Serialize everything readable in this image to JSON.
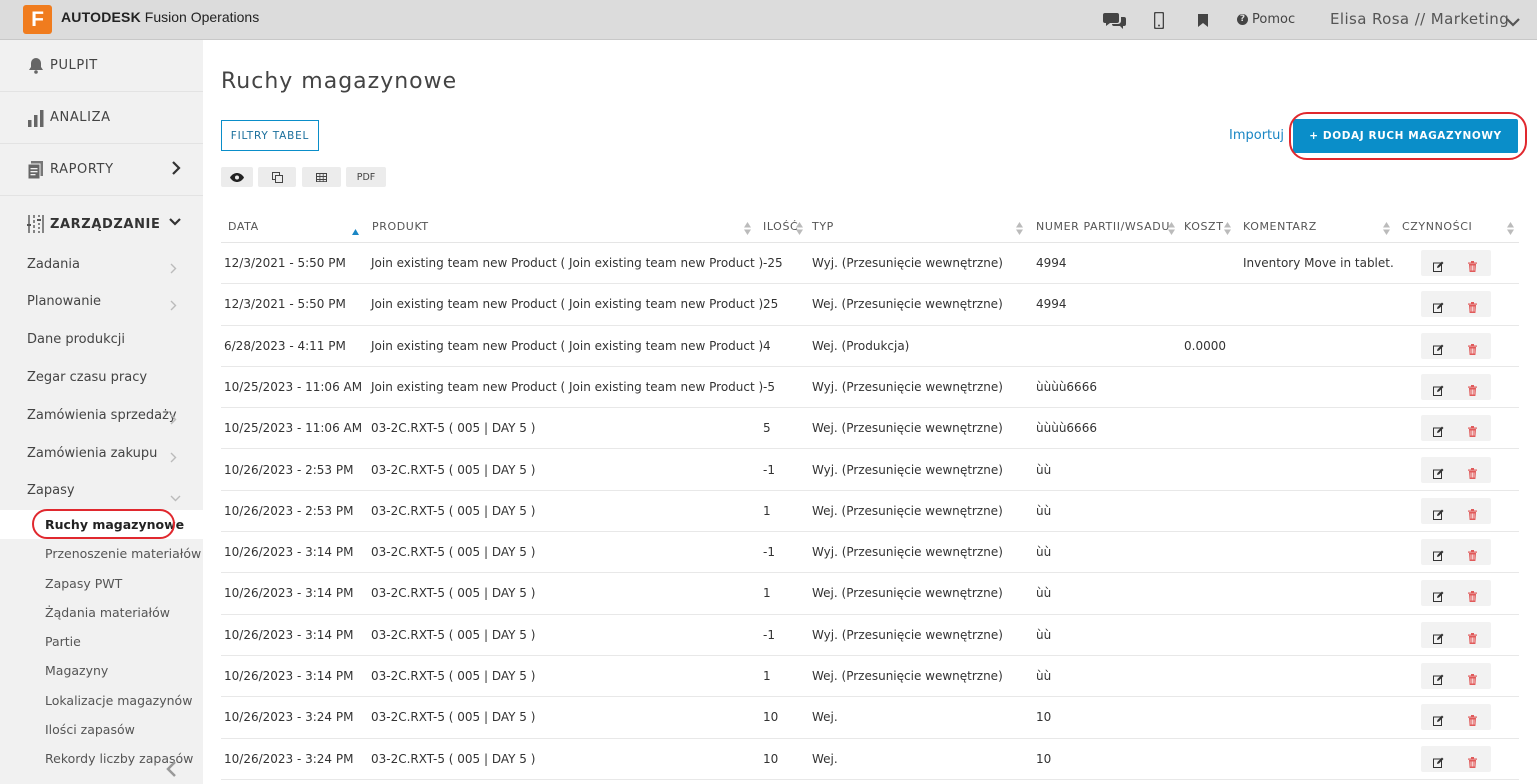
{
  "header": {
    "logo_letter": "F",
    "brand_bold": "AUTODESK",
    "brand_rest": " Fusion Operations",
    "help_label": "Pomoc",
    "user_label": "Elisa Rosa // Marketing",
    "icons": [
      "chat-icon",
      "mobile-icon",
      "bookmark-icon",
      "help-icon",
      "chevron-down-icon"
    ]
  },
  "sidebar": {
    "main": [
      {
        "label": "PULPIT",
        "icon": "bell-icon"
      },
      {
        "label": "ANALIZA",
        "icon": "bar-chart-icon"
      },
      {
        "label": "RAPORTY",
        "icon": "report-icon"
      },
      {
        "label": "ZARZĄDZANIE",
        "icon": "sliders-icon"
      }
    ],
    "sub": [
      {
        "label": "Zadania",
        "chevron": true
      },
      {
        "label": "Planowanie",
        "chevron": true
      },
      {
        "label": "Dane produkcji",
        "chevron": false
      },
      {
        "label": "Zegar czasu pracy",
        "chevron": false
      },
      {
        "label": "Zamówienia sprzedaży",
        "chevron": true
      },
      {
        "label": "Zamówienia zakupu",
        "chevron": true
      },
      {
        "label": "Zapasy",
        "chevron": true
      }
    ],
    "stock_items": [
      "Ruchy magazynowe",
      "Przenoszenie materiałów",
      "Zapasy PWT",
      "Żądania materiałów",
      "Partie",
      "Magazyny",
      "Lokalizacje magazynów",
      "Ilości zapasów",
      "Rekordy liczby zapasów"
    ]
  },
  "main": {
    "title": "Ruchy magazynowe",
    "filter_button": "FILTRY TABEL",
    "toolbar": [
      "eye-icon",
      "copy-icon",
      "table-icon",
      "PDF"
    ],
    "pdf_label": "PDF",
    "import_label": "Importuj",
    "add_button": "+ DODAJ RUCH MAGAZYNOWY"
  },
  "table": {
    "columns": [
      "DATA",
      "PRODUKT",
      "ILOŚĆ",
      "TYP",
      "NUMER PARTII/WSADU",
      "KOSZT",
      "KOMENTARZ",
      "CZYNNOŚCI"
    ],
    "rows": [
      [
        "12/3/2021 - 5:50 PM",
        "Join existing team new Product ( Join existing team new Product )",
        "-25",
        "Wyj. (Przesunięcie wewnętrzne)",
        "4994",
        "",
        "Inventory Move in tablet."
      ],
      [
        "12/3/2021 - 5:50 PM",
        "Join existing team new Product ( Join existing team new Product )",
        "25",
        "Wej. (Przesunięcie wewnętrzne)",
        "4994",
        "",
        ""
      ],
      [
        "6/28/2023 - 4:11 PM",
        "Join existing team new Product ( Join existing team new Product )",
        "4",
        "Wej. (Produkcja)",
        "",
        "0.0000",
        ""
      ],
      [
        "10/25/2023 - 11:06 AM",
        "Join existing team new Product ( Join existing team new Product )",
        "-5",
        "Wyj. (Przesunięcie wewnętrzne)",
        "ùùùù6666",
        "",
        ""
      ],
      [
        "10/25/2023 - 11:06 AM",
        "03-2C.RXT-5 ( 005 | DAY 5 )",
        "5",
        "Wej. (Przesunięcie wewnętrzne)",
        "ùùùù6666",
        "",
        ""
      ],
      [
        "10/26/2023 - 2:53 PM",
        "03-2C.RXT-5 ( 005 | DAY 5 )",
        "-1",
        "Wyj. (Przesunięcie wewnętrzne)",
        "ùù",
        "",
        ""
      ],
      [
        "10/26/2023 - 2:53 PM",
        "03-2C.RXT-5 ( 005 | DAY 5 )",
        "1",
        "Wej. (Przesunięcie wewnętrzne)",
        "ùù",
        "",
        ""
      ],
      [
        "10/26/2023 - 3:14 PM",
        "03-2C.RXT-5 ( 005 | DAY 5 )",
        "-1",
        "Wyj. (Przesunięcie wewnętrzne)",
        "ùù",
        "",
        ""
      ],
      [
        "10/26/2023 - 3:14 PM",
        "03-2C.RXT-5 ( 005 | DAY 5 )",
        "1",
        "Wej. (Przesunięcie wewnętrzne)",
        "ùù",
        "",
        ""
      ],
      [
        "10/26/2023 - 3:14 PM",
        "03-2C.RXT-5 ( 005 | DAY 5 )",
        "-1",
        "Wyj. (Przesunięcie wewnętrzne)",
        "ùù",
        "",
        ""
      ],
      [
        "10/26/2023 - 3:14 PM",
        "03-2C.RXT-5 ( 005 | DAY 5 )",
        "1",
        "Wej. (Przesunięcie wewnętrzne)",
        "ùù",
        "",
        ""
      ],
      [
        "10/26/2023 - 3:24 PM",
        "03-2C.RXT-5 ( 005 | DAY 5 )",
        "10",
        "Wej.",
        "10",
        "",
        ""
      ],
      [
        "10/26/2023 - 3:24 PM",
        "03-2C.RXT-5 ( 005 | DAY 5 )",
        "10",
        "Wej.",
        "10",
        "",
        ""
      ]
    ]
  },
  "colors": {
    "accent": "#0a8ec9",
    "highlight_ring": "#e0282e",
    "logo": "#f07c1e",
    "delete_icon": "#e05a5a"
  }
}
